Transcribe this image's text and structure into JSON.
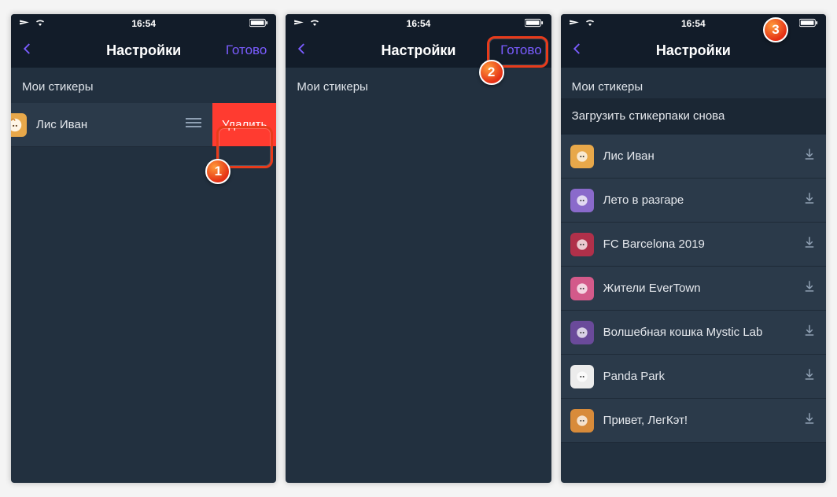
{
  "statusbar": {
    "time": "16:54"
  },
  "screen1": {
    "title": "Настройки",
    "done": "Готово",
    "section": "Мои стикеры",
    "row_label": "Лис Иван",
    "delete_label": "Удалить",
    "step": "1"
  },
  "screen2": {
    "title": "Настройки",
    "done": "Готово",
    "section": "Мои стикеры",
    "step": "2"
  },
  "screen3": {
    "title": "Настройки",
    "section_my": "Мои стикеры",
    "section_reload": "Загрузить стикерпаки снова",
    "packs": [
      {
        "label": "Лис Иван",
        "icon_bg": "#e8a84a"
      },
      {
        "label": "Лето в разгаре",
        "icon_bg": "#8a6acb"
      },
      {
        "label": "FC Barcelona 2019",
        "icon_bg": "#b0304a"
      },
      {
        "label": "Жители EverTown",
        "icon_bg": "#d35a8a"
      },
      {
        "label": "Волшебная кошка Mystic Lab",
        "icon_bg": "#6a4a9a"
      },
      {
        "label": "Panda Park",
        "icon_bg": "#ececec"
      },
      {
        "label": "Привет, ЛегКэт!",
        "icon_bg": "#d88b3a"
      }
    ],
    "step": "3"
  }
}
